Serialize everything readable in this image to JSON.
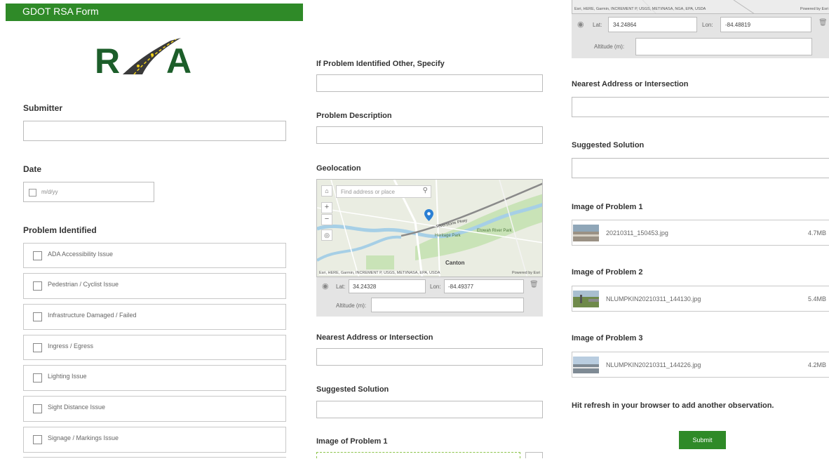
{
  "header": {
    "title": "GDOT RSA Form"
  },
  "logo": {
    "text": "RSA"
  },
  "col1": {
    "submitter_label": "Submitter",
    "date_label": "Date",
    "date_placeholder": "m/d/yy",
    "problem_label": "Problem Identified",
    "options": [
      "ADA Accessibility Issue",
      "Pedestrian / Cyclist Issue",
      "Infrastructure Damaged / Failed",
      "Ingress / Egress",
      "Lighting Issue",
      "Sight Distance Issue",
      "Signage / Markings Issue"
    ]
  },
  "col2": {
    "other_label": "If Problem Identified Other, Specify",
    "description_label": "Problem Description",
    "geolocation_label": "Geolocation",
    "map_search_placeholder": "Find address or place",
    "map_attribution": "Esri, HERE, Garmin, INCREMENT P, USGS, METI/NASA, EPA, USDA",
    "map_powered": "Powered by Esri",
    "map_labels": {
      "park1": "Heritage Park",
      "park2": "Etowah River Park",
      "city": "Canton",
      "road": "Riverstone Pkwy"
    },
    "lat_label": "Lat:",
    "lat_value": "34.24328",
    "lon_label": "Lon:",
    "lon_value": "-84.49377",
    "altitude_label": "Altitude (m):",
    "nearest_label": "Nearest Address or Intersection",
    "solution_label": "Suggested Solution",
    "image1_label": "Image of Problem 1"
  },
  "col3": {
    "map_attribution": "Esri, HERE, Garmin, INCREMENT P, USGS, METI/NASA, NGA, EPA, USDA",
    "map_powered": "Powered by Esri",
    "lat_label": "Lat:",
    "lat_value": "34.24864",
    "lon_label": "Lon:",
    "lon_value": "-84.48819",
    "altitude_label": "Altitude (m):",
    "nearest_label": "Nearest Address or Intersection",
    "solution_label": "Suggested Solution",
    "images": [
      {
        "label": "Image of Problem 1",
        "file": "20210311_150453.jpg",
        "size": "4.7MB"
      },
      {
        "label": "Image of Problem 2",
        "file": "NLUMPKIN20210311_144130.jpg",
        "size": "5.4MB"
      },
      {
        "label": "Image of Problem 3",
        "file": "NLUMPKIN20210311_144226.jpg",
        "size": "4.2MB"
      }
    ],
    "refresh_note": "Hit refresh in your browser to add another observation.",
    "submit_label": "Submit"
  },
  "colors": {
    "brand_green": "#2f8a28",
    "logo_green": "#1c5e2a",
    "pin_blue": "#2a7fd4"
  }
}
